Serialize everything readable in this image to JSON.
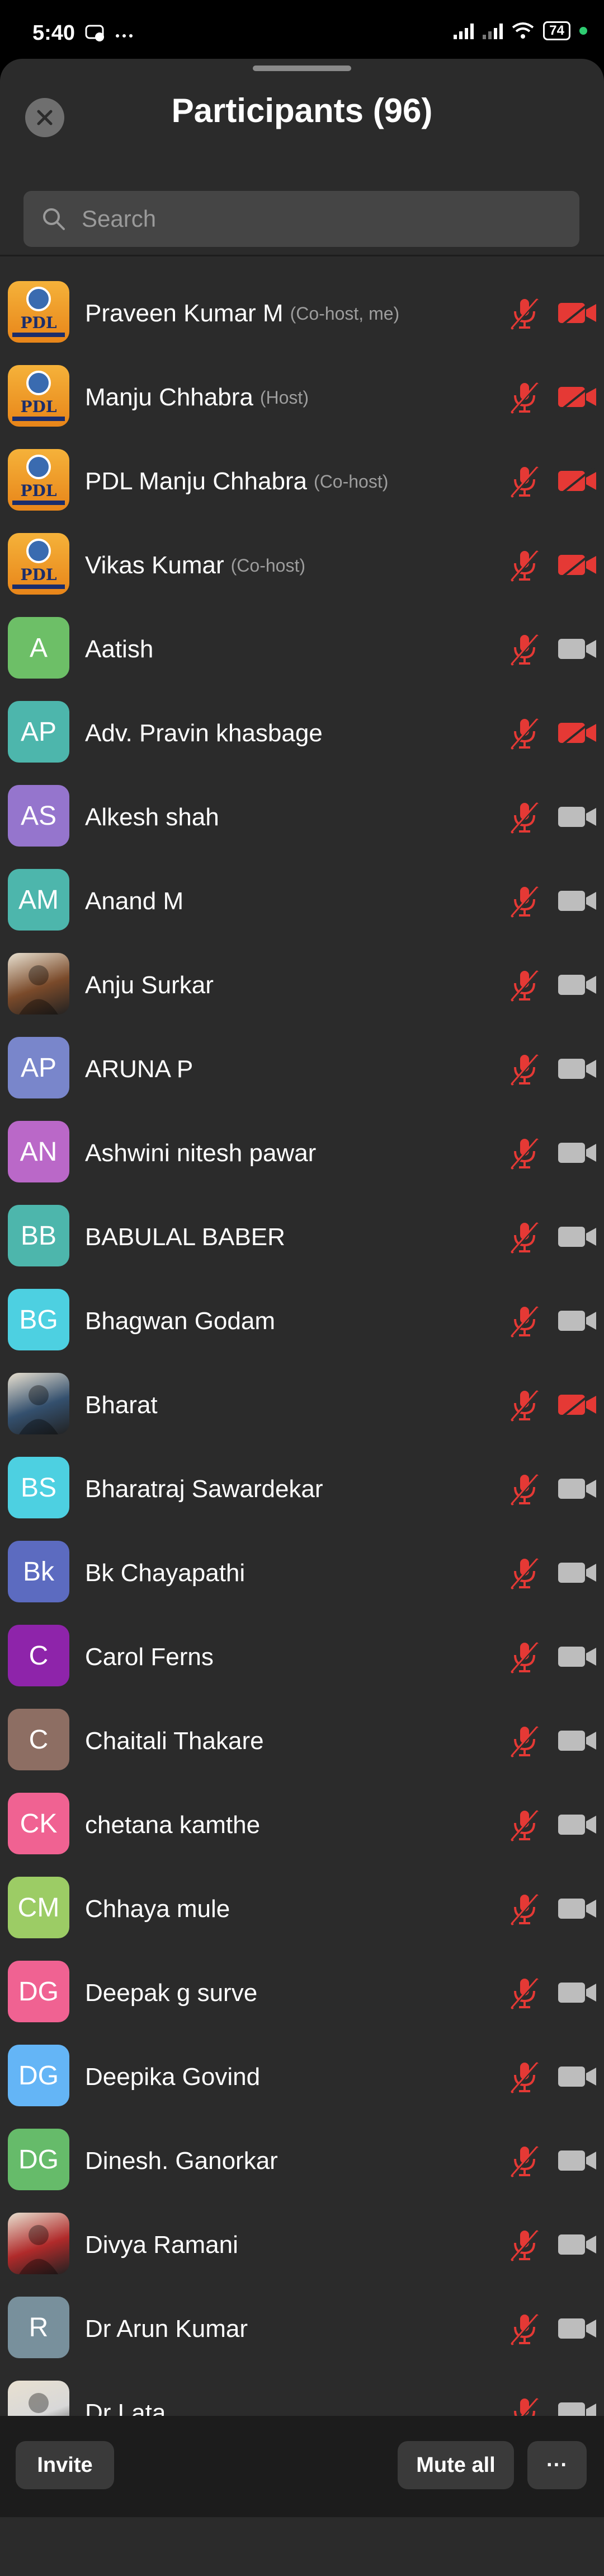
{
  "status_bar": {
    "time": "5:40",
    "battery": "74"
  },
  "header": {
    "title": "Participants (96)"
  },
  "search": {
    "placeholder": "Search"
  },
  "participants": [
    {
      "name": "Praveen Kumar M",
      "role": "(Co-host, me)",
      "avatar_text": "",
      "avatar_type": "logo",
      "avatar_color": "#f0a030",
      "video_off": true
    },
    {
      "name": "Manju Chhabra",
      "role": "(Host)",
      "avatar_text": "",
      "avatar_type": "logo",
      "avatar_color": "#f0a030",
      "video_off": true
    },
    {
      "name": "PDL Manju Chhabra",
      "role": "(Co-host)",
      "avatar_text": "",
      "avatar_type": "logo",
      "avatar_color": "#f0a030",
      "video_off": true
    },
    {
      "name": "Vikas Kumar",
      "role": "(Co-host)",
      "avatar_text": "",
      "avatar_type": "logo",
      "avatar_color": "#f0a030",
      "video_off": true
    },
    {
      "name": "Aatish",
      "role": "",
      "avatar_text": "A",
      "avatar_type": "initials",
      "avatar_color": "#6dbf67",
      "video_off": false
    },
    {
      "name": "Adv. Pravin khasbage",
      "role": "",
      "avatar_text": "AP",
      "avatar_type": "initials",
      "avatar_color": "#4db6ac",
      "video_off": true
    },
    {
      "name": "Alkesh shah",
      "role": "",
      "avatar_text": "AS",
      "avatar_type": "initials",
      "avatar_color": "#9575cd",
      "video_off": false
    },
    {
      "name": "Anand M",
      "role": "",
      "avatar_text": "AM",
      "avatar_type": "initials",
      "avatar_color": "#4db6ac",
      "video_off": false
    },
    {
      "name": "Anju Surkar",
      "role": "",
      "avatar_text": "",
      "avatar_type": "photo",
      "avatar_color": "#7a4a2a",
      "video_off": false
    },
    {
      "name": "ARUNA P",
      "role": "",
      "avatar_text": "AP",
      "avatar_type": "initials",
      "avatar_color": "#7986cb",
      "video_off": false
    },
    {
      "name": "Ashwini nitesh pawar",
      "role": "",
      "avatar_text": "AN",
      "avatar_type": "initials",
      "avatar_color": "#ba68c8",
      "video_off": false
    },
    {
      "name": "BABULAL BABER",
      "role": "",
      "avatar_text": "BB",
      "avatar_type": "initials",
      "avatar_color": "#4db6ac",
      "video_off": false
    },
    {
      "name": "Bhagwan Godam",
      "role": "",
      "avatar_text": "BG",
      "avatar_type": "initials",
      "avatar_color": "#4dd0e1",
      "video_off": false
    },
    {
      "name": "Bharat",
      "role": "",
      "avatar_text": "",
      "avatar_type": "photo",
      "avatar_color": "#34506e",
      "video_off": true
    },
    {
      "name": "Bharatraj Sawardekar",
      "role": "",
      "avatar_text": "BS",
      "avatar_type": "initials",
      "avatar_color": "#4dd0e1",
      "video_off": false
    },
    {
      "name": "Bk Chayapathi",
      "role": "",
      "avatar_text": "Bk",
      "avatar_type": "initials",
      "avatar_color": "#5c6bc0",
      "video_off": false
    },
    {
      "name": "Carol Ferns",
      "role": "",
      "avatar_text": "C",
      "avatar_type": "initials",
      "avatar_color": "#8e24aa",
      "video_off": false
    },
    {
      "name": "Chaitali Thakare",
      "role": "",
      "avatar_text": "C",
      "avatar_type": "initials",
      "avatar_color": "#8d6e63",
      "video_off": false
    },
    {
      "name": "chetana kamthe",
      "role": "",
      "avatar_text": "CK",
      "avatar_type": "initials",
      "avatar_color": "#f06292",
      "video_off": false
    },
    {
      "name": "Chhaya mule",
      "role": "",
      "avatar_text": "CM",
      "avatar_type": "initials",
      "avatar_color": "#9ccc65",
      "video_off": false
    },
    {
      "name": "Deepak g surve",
      "role": "",
      "avatar_text": "DG",
      "avatar_type": "initials",
      "avatar_color": "#f06292",
      "video_off": false
    },
    {
      "name": "Deepika Govind",
      "role": "",
      "avatar_text": "DG",
      "avatar_type": "initials",
      "avatar_color": "#64b5f6",
      "video_off": false
    },
    {
      "name": "Dinesh. Ganorkar",
      "role": "",
      "avatar_text": "DG",
      "avatar_type": "initials",
      "avatar_color": "#66bb6a",
      "video_off": false
    },
    {
      "name": "Divya Ramani",
      "role": "",
      "avatar_text": "",
      "avatar_type": "photo",
      "avatar_color": "#b02a2a",
      "video_off": false
    },
    {
      "name": "Dr Arun Kumar",
      "role": "",
      "avatar_text": "R",
      "avatar_type": "initials",
      "avatar_color": "#78909c",
      "video_off": false
    },
    {
      "name": "Dr Lata",
      "role": "",
      "avatar_text": "",
      "avatar_type": "photo",
      "avatar_color": "#d8d8d8",
      "video_off": false
    }
  ],
  "logo_text": "PDL",
  "bottom": {
    "invite": "Invite",
    "mute_all": "Mute all",
    "more": "···"
  },
  "colors": {
    "muted_red": "#e53935",
    "sheet_bg": "#2b2b2b",
    "camera_gray": "#bdbdbd"
  },
  "icons": {
    "mic": "mic-muted-icon",
    "video_off": "video-off-icon",
    "video_on": "video-icon"
  }
}
